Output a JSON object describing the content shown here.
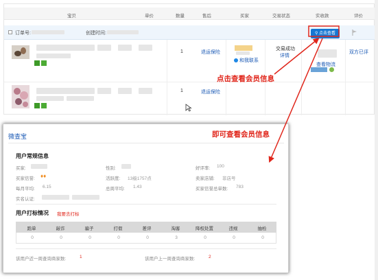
{
  "header": {
    "columns": [
      "宝贝",
      "单价",
      "数量",
      "售后",
      "买家",
      "交易状态",
      "实收款",
      "评价"
    ]
  },
  "order_group": {
    "order_no_label": "订单号:",
    "created_label": "创建时间:",
    "query_button": "点击查看"
  },
  "rows": [
    {
      "qty": "1",
      "service": "退运保险",
      "contact": "和我联系",
      "status": "交易成功",
      "detail": "详情",
      "logistics": "查看物流",
      "rate": "双方已评"
    },
    {
      "qty": "1",
      "service": "退运保险"
    }
  ],
  "callouts": {
    "click_view": "点击查看会员信息",
    "instant_view": "即可查看会员信息"
  },
  "panel": {
    "title": "微查宝",
    "basic_title": "用户常规信息",
    "fields": {
      "buyer": "买家:",
      "gender": "性别:",
      "good_rate": "好评率:",
      "good_rate_value": "100",
      "reputation": "买家信誉:",
      "activity": "活跃度:",
      "activity_value": "13级1757点",
      "shop": "卖家店铺:",
      "shop_value": "非店号",
      "monthly": "每月平均:",
      "monthly_value": "6.15",
      "total": "总周平均:",
      "total_value": "1.43",
      "seller_total": "买家信誉总单数:",
      "seller_total_value": "783",
      "realname": "实名认证:"
    },
    "report_title": "用户打标情况",
    "report_link": "我要去打标",
    "table": {
      "headers": [
        "跑单",
        "敲诈",
        "骗子",
        "打假",
        "差评",
        "淘客",
        "降权处置",
        "违规",
        "抽检"
      ],
      "values": [
        "0",
        "0",
        "0",
        "0",
        "0",
        "3",
        "0",
        "0",
        "0"
      ]
    },
    "footer": {
      "last_week_label": "该用户近一周查询商家数:",
      "last_week_value": "1",
      "prev_week_label": "该用户上一周查询商家数:",
      "prev_week_value": "2"
    }
  },
  "colors": {
    "accent": "#1677d2",
    "callout": "#e0261b",
    "link": "#1b5ab5"
  }
}
